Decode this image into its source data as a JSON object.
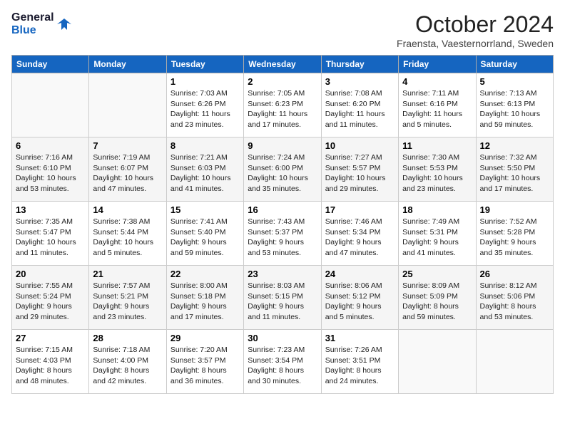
{
  "header": {
    "logo_line1": "General",
    "logo_line2": "Blue",
    "month": "October 2024",
    "location": "Fraensta, Vaesternorrland, Sweden"
  },
  "days_of_week": [
    "Sunday",
    "Monday",
    "Tuesday",
    "Wednesday",
    "Thursday",
    "Friday",
    "Saturday"
  ],
  "weeks": [
    [
      {
        "day": "",
        "text": ""
      },
      {
        "day": "",
        "text": ""
      },
      {
        "day": "1",
        "text": "Sunrise: 7:03 AM\nSunset: 6:26 PM\nDaylight: 11 hours and 23 minutes."
      },
      {
        "day": "2",
        "text": "Sunrise: 7:05 AM\nSunset: 6:23 PM\nDaylight: 11 hours and 17 minutes."
      },
      {
        "day": "3",
        "text": "Sunrise: 7:08 AM\nSunset: 6:20 PM\nDaylight: 11 hours and 11 minutes."
      },
      {
        "day": "4",
        "text": "Sunrise: 7:11 AM\nSunset: 6:16 PM\nDaylight: 11 hours and 5 minutes."
      },
      {
        "day": "5",
        "text": "Sunrise: 7:13 AM\nSunset: 6:13 PM\nDaylight: 10 hours and 59 minutes."
      }
    ],
    [
      {
        "day": "6",
        "text": "Sunrise: 7:16 AM\nSunset: 6:10 PM\nDaylight: 10 hours and 53 minutes."
      },
      {
        "day": "7",
        "text": "Sunrise: 7:19 AM\nSunset: 6:07 PM\nDaylight: 10 hours and 47 minutes."
      },
      {
        "day": "8",
        "text": "Sunrise: 7:21 AM\nSunset: 6:03 PM\nDaylight: 10 hours and 41 minutes."
      },
      {
        "day": "9",
        "text": "Sunrise: 7:24 AM\nSunset: 6:00 PM\nDaylight: 10 hours and 35 minutes."
      },
      {
        "day": "10",
        "text": "Sunrise: 7:27 AM\nSunset: 5:57 PM\nDaylight: 10 hours and 29 minutes."
      },
      {
        "day": "11",
        "text": "Sunrise: 7:30 AM\nSunset: 5:53 PM\nDaylight: 10 hours and 23 minutes."
      },
      {
        "day": "12",
        "text": "Sunrise: 7:32 AM\nSunset: 5:50 PM\nDaylight: 10 hours and 17 minutes."
      }
    ],
    [
      {
        "day": "13",
        "text": "Sunrise: 7:35 AM\nSunset: 5:47 PM\nDaylight: 10 hours and 11 minutes."
      },
      {
        "day": "14",
        "text": "Sunrise: 7:38 AM\nSunset: 5:44 PM\nDaylight: 10 hours and 5 minutes."
      },
      {
        "day": "15",
        "text": "Sunrise: 7:41 AM\nSunset: 5:40 PM\nDaylight: 9 hours and 59 minutes."
      },
      {
        "day": "16",
        "text": "Sunrise: 7:43 AM\nSunset: 5:37 PM\nDaylight: 9 hours and 53 minutes."
      },
      {
        "day": "17",
        "text": "Sunrise: 7:46 AM\nSunset: 5:34 PM\nDaylight: 9 hours and 47 minutes."
      },
      {
        "day": "18",
        "text": "Sunrise: 7:49 AM\nSunset: 5:31 PM\nDaylight: 9 hours and 41 minutes."
      },
      {
        "day": "19",
        "text": "Sunrise: 7:52 AM\nSunset: 5:28 PM\nDaylight: 9 hours and 35 minutes."
      }
    ],
    [
      {
        "day": "20",
        "text": "Sunrise: 7:55 AM\nSunset: 5:24 PM\nDaylight: 9 hours and 29 minutes."
      },
      {
        "day": "21",
        "text": "Sunrise: 7:57 AM\nSunset: 5:21 PM\nDaylight: 9 hours and 23 minutes."
      },
      {
        "day": "22",
        "text": "Sunrise: 8:00 AM\nSunset: 5:18 PM\nDaylight: 9 hours and 17 minutes."
      },
      {
        "day": "23",
        "text": "Sunrise: 8:03 AM\nSunset: 5:15 PM\nDaylight: 9 hours and 11 minutes."
      },
      {
        "day": "24",
        "text": "Sunrise: 8:06 AM\nSunset: 5:12 PM\nDaylight: 9 hours and 5 minutes."
      },
      {
        "day": "25",
        "text": "Sunrise: 8:09 AM\nSunset: 5:09 PM\nDaylight: 8 hours and 59 minutes."
      },
      {
        "day": "26",
        "text": "Sunrise: 8:12 AM\nSunset: 5:06 PM\nDaylight: 8 hours and 53 minutes."
      }
    ],
    [
      {
        "day": "27",
        "text": "Sunrise: 7:15 AM\nSunset: 4:03 PM\nDaylight: 8 hours and 48 minutes."
      },
      {
        "day": "28",
        "text": "Sunrise: 7:18 AM\nSunset: 4:00 PM\nDaylight: 8 hours and 42 minutes."
      },
      {
        "day": "29",
        "text": "Sunrise: 7:20 AM\nSunset: 3:57 PM\nDaylight: 8 hours and 36 minutes."
      },
      {
        "day": "30",
        "text": "Sunrise: 7:23 AM\nSunset: 3:54 PM\nDaylight: 8 hours and 30 minutes."
      },
      {
        "day": "31",
        "text": "Sunrise: 7:26 AM\nSunset: 3:51 PM\nDaylight: 8 hours and 24 minutes."
      },
      {
        "day": "",
        "text": ""
      },
      {
        "day": "",
        "text": ""
      }
    ]
  ]
}
